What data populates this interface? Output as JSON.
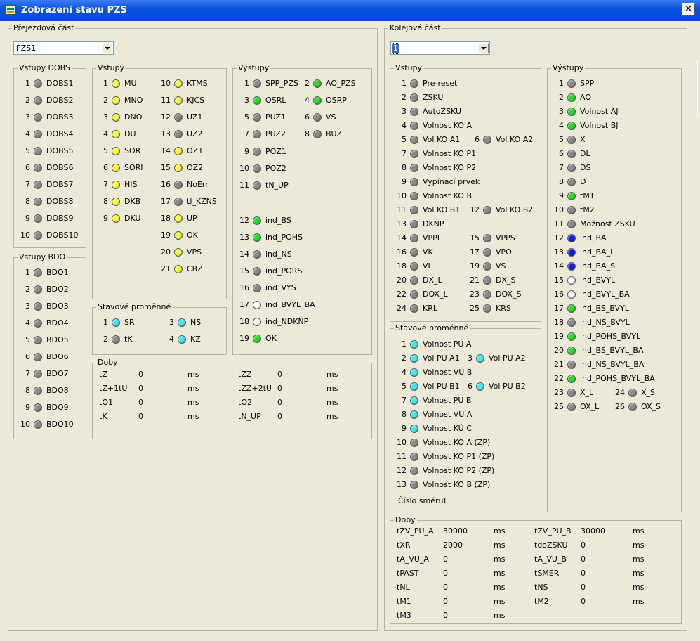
{
  "window": {
    "title": "Zobrazení stavu PZS",
    "close_glyph": "✕"
  },
  "colors": {
    "gray": "#8a8a8a",
    "yellow": "#ffff3a",
    "green": "#28dc28",
    "cyan": "#40e8f0",
    "blue": "#1020e0",
    "white": "#ffffff"
  },
  "left": {
    "title": "Přejezdová část",
    "combo_value": "PZS1",
    "dobs": {
      "title": "Vstupy DOBS",
      "items": [
        {
          "n": "1",
          "label": "DOBS1",
          "color": "gray"
        },
        {
          "n": "2",
          "label": "DOBS2",
          "color": "gray"
        },
        {
          "n": "3",
          "label": "DOBS3",
          "color": "gray"
        },
        {
          "n": "4",
          "label": "DOBS4",
          "color": "gray"
        },
        {
          "n": "5",
          "label": "DOBS5",
          "color": "gray"
        },
        {
          "n": "6",
          "label": "DOBS6",
          "color": "gray"
        },
        {
          "n": "7",
          "label": "DOBS7",
          "color": "gray"
        },
        {
          "n": "8",
          "label": "DOBS8",
          "color": "gray"
        },
        {
          "n": "9",
          "label": "DOBS9",
          "color": "gray"
        },
        {
          "n": "10",
          "label": "DOBS10",
          "color": "gray"
        }
      ]
    },
    "bdo": {
      "title": "Vstupy BDO",
      "items": [
        {
          "n": "1",
          "label": "BDO1",
          "color": "gray"
        },
        {
          "n": "2",
          "label": "BDO2",
          "color": "gray"
        },
        {
          "n": "3",
          "label": "BDO3",
          "color": "gray"
        },
        {
          "n": "4",
          "label": "BDO4",
          "color": "gray"
        },
        {
          "n": "5",
          "label": "BDO5",
          "color": "gray"
        },
        {
          "n": "6",
          "label": "BDO6",
          "color": "gray"
        },
        {
          "n": "7",
          "label": "BDO7",
          "color": "gray"
        },
        {
          "n": "8",
          "label": "BDO8",
          "color": "gray"
        },
        {
          "n": "9",
          "label": "BDO9",
          "color": "gray"
        },
        {
          "n": "10",
          "label": "BDO10",
          "color": "gray"
        }
      ]
    },
    "vstupy": {
      "title": "Vstupy",
      "col1": [
        {
          "n": "1",
          "label": "MU",
          "color": "yellow"
        },
        {
          "n": "2",
          "label": "MNO",
          "color": "yellow"
        },
        {
          "n": "3",
          "label": "DNO",
          "color": "yellow"
        },
        {
          "n": "4",
          "label": "DU",
          "color": "yellow"
        },
        {
          "n": "5",
          "label": "SOR",
          "color": "yellow"
        },
        {
          "n": "6",
          "label": "SORI",
          "color": "yellow"
        },
        {
          "n": "7",
          "label": "HIS",
          "color": "yellow"
        },
        {
          "n": "8",
          "label": "DKB",
          "color": "yellow"
        },
        {
          "n": "9",
          "label": "DKU",
          "color": "yellow"
        }
      ],
      "col2": [
        {
          "n": "10",
          "label": "KTMS",
          "color": "yellow"
        },
        {
          "n": "11",
          "label": "KJCS",
          "color": "yellow"
        },
        {
          "n": "12",
          "label": "UZ1",
          "color": "gray"
        },
        {
          "n": "13",
          "label": "UZ2",
          "color": "gray"
        },
        {
          "n": "14",
          "label": "OZ1",
          "color": "yellow"
        },
        {
          "n": "15",
          "label": "OZ2",
          "color": "yellow"
        },
        {
          "n": "16",
          "label": "NoErr",
          "color": "gray"
        },
        {
          "n": "17",
          "label": "tl_KZNS",
          "color": "gray"
        },
        {
          "n": "18",
          "label": "UP",
          "color": "yellow"
        },
        {
          "n": "19",
          "label": "OK",
          "color": "yellow"
        },
        {
          "n": "20",
          "label": "VPS",
          "color": "yellow"
        },
        {
          "n": "21",
          "label": "CBZ",
          "color": "yellow"
        }
      ]
    },
    "stav": {
      "title": "Stavové proměnné",
      "items": [
        {
          "n": "1",
          "label": "SR",
          "color": "cyan"
        },
        {
          "n": "3",
          "label": "NS",
          "color": "cyan"
        },
        {
          "n": "2",
          "label": "tK",
          "color": "gray"
        },
        {
          "n": "4",
          "label": "KZ",
          "color": "cyan"
        }
      ]
    },
    "vystupy": {
      "title": "Výstupy",
      "items": [
        {
          "n": "1",
          "label": "SPP_PZS",
          "color": "gray"
        },
        {
          "n": "2",
          "label": "AO_PZS",
          "color": "green"
        },
        {
          "n": "3",
          "label": "OSRL",
          "color": "green"
        },
        {
          "n": "4",
          "label": "OSRP",
          "color": "green"
        },
        {
          "n": "5",
          "label": "PUZ1",
          "color": "gray"
        },
        {
          "n": "6",
          "label": "VS",
          "color": "gray"
        },
        {
          "n": "7",
          "label": "PUZ2",
          "color": "gray"
        },
        {
          "n": "8",
          "label": "BUZ",
          "color": "gray"
        },
        {
          "n": "9",
          "label": "POZ1",
          "color": "gray"
        },
        {
          "n": "10",
          "label": "POZ2",
          "color": "gray"
        },
        {
          "n": "11",
          "label": "tN_UP",
          "color": "gray"
        },
        {
          "n": "12",
          "label": "ind_BS",
          "color": "green"
        },
        {
          "n": "13",
          "label": "ind_POHS",
          "color": "green"
        },
        {
          "n": "14",
          "label": "ind_NS",
          "color": "gray"
        },
        {
          "n": "15",
          "label": "ind_PORS",
          "color": "gray"
        },
        {
          "n": "16",
          "label": "ind_VYS",
          "color": "gray"
        },
        {
          "n": "17",
          "label": "ind_BVYL_BA",
          "color": "white"
        },
        {
          "n": "18",
          "label": "ind_NDKNP",
          "color": "white"
        },
        {
          "n": "19",
          "label": "OK",
          "color": "green"
        }
      ]
    },
    "doby": {
      "title": "Doby",
      "rows": [
        {
          "k1": "tZ",
          "v1": "0",
          "u1": "ms",
          "k2": "tZZ",
          "v2": "0",
          "u2": "ms"
        },
        {
          "k1": "tZ+1tU",
          "v1": "0",
          "u1": "ms",
          "k2": "tZZ+2tU",
          "v2": "0",
          "u2": "ms"
        },
        {
          "k1": "tO1",
          "v1": "0",
          "u1": "ms",
          "k2": "tO2",
          "v2": "0",
          "u2": "ms"
        },
        {
          "k1": "tK",
          "v1": "0",
          "u1": "ms",
          "k2": "tN_UP",
          "v2": "0",
          "u2": "ms"
        }
      ]
    }
  },
  "right": {
    "title": "Kolejová část",
    "combo_value": "1",
    "vstupy": {
      "title": "Vstupy",
      "items": [
        {
          "n": "1",
          "label": "Pre-reset",
          "color": "gray"
        },
        {
          "n": "2",
          "label": "ZSKU",
          "color": "gray"
        },
        {
          "n": "3",
          "label": "AutoZSKU",
          "color": "gray"
        },
        {
          "n": "4",
          "label": "Volnost KO A",
          "color": "gray"
        },
        {
          "n": "5",
          "label": "Vol KO A1",
          "color": "gray"
        },
        {
          "n": "6",
          "label": "Vol KO A2",
          "color": "gray"
        },
        {
          "n": "7",
          "label": "Volnost KO P1",
          "color": "gray"
        },
        {
          "n": "8",
          "label": "Volnost KO P2",
          "color": "gray"
        },
        {
          "n": "9",
          "label": "Vypínací prvek",
          "color": "gray"
        },
        {
          "n": "10",
          "label": "Volnost KO B",
          "color": "gray"
        },
        {
          "n": "11",
          "label": "Vol KO B1",
          "color": "gray"
        },
        {
          "n": "12",
          "label": "Vol KO B2",
          "color": "gray"
        },
        {
          "n": "13",
          "label": "DKNP",
          "color": "gray"
        },
        {
          "n": "14",
          "label": "VPPL",
          "color": "gray"
        },
        {
          "n": "15",
          "label": "VPPS",
          "color": "gray"
        },
        {
          "n": "16",
          "label": "VK",
          "color": "gray"
        },
        {
          "n": "17",
          "label": "VPO",
          "color": "gray"
        },
        {
          "n": "18",
          "label": "VL",
          "color": "gray"
        },
        {
          "n": "19",
          "label": "VS",
          "color": "gray"
        },
        {
          "n": "20",
          "label": "DX_L",
          "color": "gray"
        },
        {
          "n": "21",
          "label": "DX_S",
          "color": "gray"
        },
        {
          "n": "22",
          "label": "DOX_L",
          "color": "gray"
        },
        {
          "n": "23",
          "label": "DOX_S",
          "color": "gray"
        },
        {
          "n": "24",
          "label": "KRL",
          "color": "gray"
        },
        {
          "n": "25",
          "label": "KRS",
          "color": "gray"
        }
      ]
    },
    "stav": {
      "title": "Stavové proměnné",
      "items": [
        {
          "n": "1",
          "label": "Volnost PÚ A",
          "color": "cyan"
        },
        {
          "n": "2",
          "label": "Vol PÚ A1",
          "color": "cyan"
        },
        {
          "n": "3",
          "label": "Vol PÚ A2",
          "color": "cyan"
        },
        {
          "n": "4",
          "label": "Volnost VÚ B",
          "color": "cyan"
        },
        {
          "n": "5",
          "label": "Vol PÚ B1",
          "color": "cyan"
        },
        {
          "n": "6",
          "label": "Vol PÚ B2",
          "color": "cyan"
        },
        {
          "n": "7",
          "label": "Volnost PÚ B",
          "color": "cyan"
        },
        {
          "n": "8",
          "label": "Volnost VÚ A",
          "color": "cyan"
        },
        {
          "n": "9",
          "label": "Volnost KÚ C",
          "color": "cyan"
        },
        {
          "n": "10",
          "label": "Volnost KO A (ZP)",
          "color": "gray"
        },
        {
          "n": "11",
          "label": "Volnost KO P1 (ZP)",
          "color": "gray"
        },
        {
          "n": "12",
          "label": "Volnost KO P2 (ZP)",
          "color": "gray"
        },
        {
          "n": "13",
          "label": "Volnost KO B (ZP)",
          "color": "gray"
        }
      ],
      "cislo_label": "Číslo směru:",
      "cislo_value": "1"
    },
    "vystupy": {
      "title": "Výstupy",
      "items": [
        {
          "n": "1",
          "label": "SPP",
          "color": "gray"
        },
        {
          "n": "2",
          "label": "AO",
          "color": "green"
        },
        {
          "n": "3",
          "label": "Volnost AJ",
          "color": "green"
        },
        {
          "n": "4",
          "label": "Volnost BJ",
          "color": "green"
        },
        {
          "n": "5",
          "label": "X",
          "color": "gray"
        },
        {
          "n": "6",
          "label": "DL",
          "color": "gray"
        },
        {
          "n": "7",
          "label": "DS",
          "color": "gray"
        },
        {
          "n": "8",
          "label": "D",
          "color": "gray"
        },
        {
          "n": "9",
          "label": "tM1",
          "color": "green"
        },
        {
          "n": "10",
          "label": "tM2",
          "color": "gray"
        },
        {
          "n": "11",
          "label": "Možnost ZSKU",
          "color": "gray"
        },
        {
          "n": "12",
          "label": "ind_BA",
          "color": "blue"
        },
        {
          "n": "13",
          "label": "ind_BA_L",
          "color": "blue"
        },
        {
          "n": "14",
          "label": "ind_BA_S",
          "color": "blue"
        },
        {
          "n": "15",
          "label": "ind_BVYL",
          "color": "white"
        },
        {
          "n": "16",
          "label": "ind_BVYL_BA",
          "color": "white"
        },
        {
          "n": "17",
          "label": "ind_BS_BVYL",
          "color": "green"
        },
        {
          "n": "18",
          "label": "ind_NS_BVYL",
          "color": "gray"
        },
        {
          "n": "19",
          "label": "ind_POHS_BVYL",
          "color": "green"
        },
        {
          "n": "20",
          "label": "ind_BS_BVYL_BA",
          "color": "green"
        },
        {
          "n": "21",
          "label": "ind_NS_BVYL_BA",
          "color": "gray"
        },
        {
          "n": "22",
          "label": "ind_POHS_BVYL_BA",
          "color": "green"
        },
        {
          "n": "23",
          "label": "X_L",
          "color": "gray"
        },
        {
          "n": "24",
          "label": "X_S",
          "color": "gray"
        },
        {
          "n": "25",
          "label": "OX_L",
          "color": "gray"
        },
        {
          "n": "26",
          "label": "OX_S",
          "color": "gray"
        }
      ]
    },
    "doby": {
      "title": "Doby",
      "rows": [
        {
          "k1": "tZV_PU_A",
          "v1": "30000",
          "u1": "ms",
          "k2": "tZV_PU_B",
          "v2": "30000",
          "u2": "ms"
        },
        {
          "k1": "tXR",
          "v1": "2000",
          "u1": "ms",
          "k2": "tdoZSKU",
          "v2": "0",
          "u2": "ms"
        },
        {
          "k1": "tA_VU_A",
          "v1": "0",
          "u1": "ms",
          "k2": "tA_VU_B",
          "v2": "0",
          "u2": "ms"
        },
        {
          "k1": "tPAST",
          "v1": "0",
          "u1": "ms",
          "k2": "tSMER",
          "v2": "0",
          "u2": "ms"
        },
        {
          "k1": "tNL",
          "v1": "0",
          "u1": "ms",
          "k2": "tNS",
          "v2": "0",
          "u2": "ms"
        },
        {
          "k1": "tM1",
          "v1": "0",
          "u1": "ms",
          "k2": "tM2",
          "v2": "0",
          "u2": "ms"
        },
        {
          "k1": "tM3",
          "v1": "0",
          "u1": "ms",
          "k2": "",
          "v2": "",
          "u2": ""
        }
      ]
    }
  }
}
